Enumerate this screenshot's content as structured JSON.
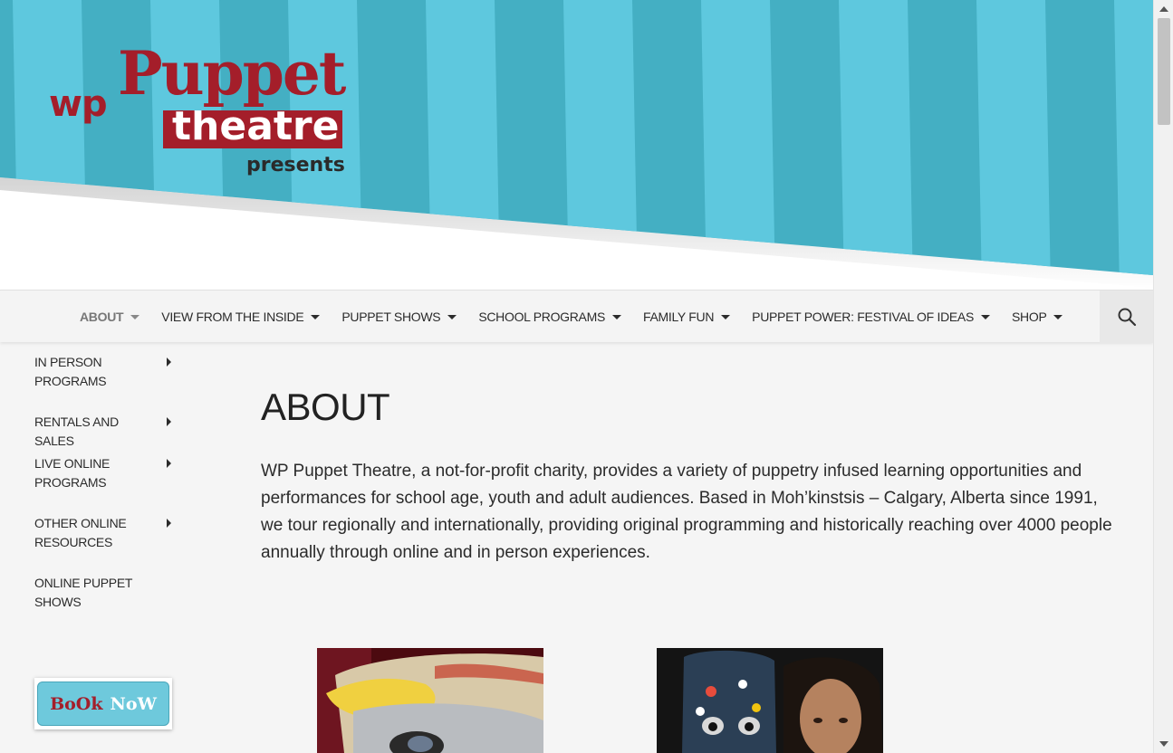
{
  "colors": {
    "stripe_light": "#5ec8de",
    "stripe_dark": "#44afc3",
    "brand_red": "#a41e2a",
    "nav_bg": "#f4f4f4",
    "page_bg": "#f5f5f5"
  },
  "header": {
    "logo": {
      "wp": "wp",
      "puppet": "Puppet",
      "theatre": "theatre",
      "presents": "presents"
    }
  },
  "nav": {
    "items": [
      {
        "label": "ABOUT",
        "active": true
      },
      {
        "label": "VIEW FROM THE INSIDE",
        "active": false
      },
      {
        "label": "PUPPET SHOWS",
        "active": false
      },
      {
        "label": "SCHOOL PROGRAMS",
        "active": false
      },
      {
        "label": "FAMILY FUN",
        "active": false
      },
      {
        "label": "PUPPET POWER: FESTIVAL OF IDEAS",
        "active": false
      },
      {
        "label": "SHOP",
        "active": false
      }
    ],
    "search_icon": "search-icon"
  },
  "sidebar": {
    "items": [
      {
        "label": "IN PERSON PROGRAMS",
        "has_submenu": true
      },
      {
        "label": "RENTALS AND SALES",
        "has_submenu": true
      },
      {
        "label": "LIVE ONLINE PROGRAMS",
        "has_submenu": true
      },
      {
        "label": "OTHER ONLINE RESOURCES",
        "has_submenu": true
      },
      {
        "label": "ONLINE PUPPET SHOWS",
        "has_submenu": false
      }
    ]
  },
  "main": {
    "title": "ABOUT",
    "intro": "WP Puppet Theatre, a not-for-profit charity, provides a variety  of puppetry infused learning opportunities and performances for school age, youth and adult audiences.  Based in Moh’kinstsis – Calgary, Alberta since 1991,  we tour regionally and internationally, providing original programming and historically reaching over 4000 people annually through online and in person experiences."
  },
  "book_now": {
    "word1": "BoOk",
    "word2": "NoW"
  }
}
